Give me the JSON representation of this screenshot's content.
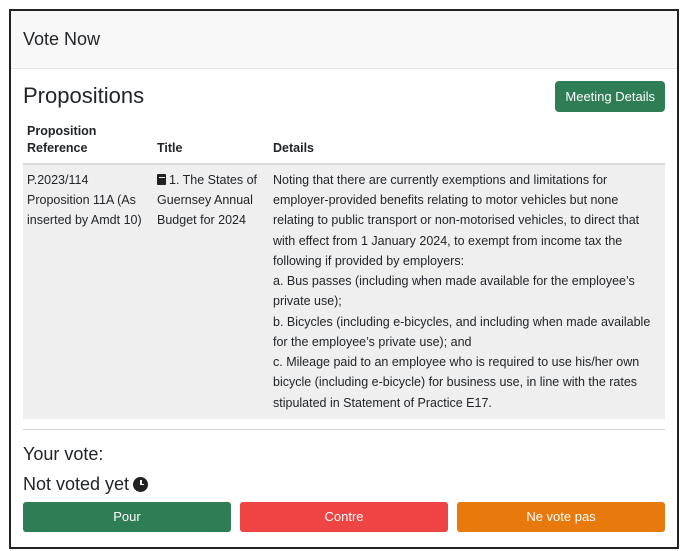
{
  "header": {
    "title": "Vote Now"
  },
  "propositions": {
    "heading": "Propositions",
    "meeting_details_label": "Meeting Details",
    "columns": {
      "reference_line1": "Proposition",
      "reference_line2": "Reference",
      "title": "Title",
      "details": "Details"
    },
    "row": {
      "reference": "P.2023/114 Proposition 11A (As inserted by Amdt 10)",
      "title": "1. The States of Guernsey Annual Budget for 2024",
      "details_intro": "Noting that there are currently exemptions and limitations for employer-provided benefits relating to motor vehicles but none relating to public transport or non-motorised vehicles, to direct that with effect from 1 January 2024, to exempt from income tax the following if provided by employers:",
      "details_a": "a. Bus passes (including when made available for the employee’s private use);",
      "details_b": "b. Bicycles (including e-bicycles, and including when made available for the employee’s private use); and",
      "details_c": "c. Mileage paid to an employee who is required to use his/her own bicycle (including e-bicycle) for business use, in line with the rates stipulated in Statement of Practice E17."
    }
  },
  "vote": {
    "label": "Your vote:",
    "status": "Not voted yet",
    "status_icon": "clock-icon",
    "buttons": {
      "pour": "Pour",
      "contre": "Contre",
      "ne_vote_pas": "Ne vote pas"
    },
    "colors": {
      "pour": "#2f7d55",
      "contre": "#ef4444",
      "ne_vote_pas": "#e8790c"
    }
  }
}
